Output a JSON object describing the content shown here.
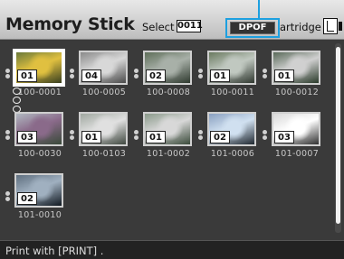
{
  "header": {
    "title": "Memory Stick",
    "select_label": "Select",
    "select_count": "0011",
    "dpof_label": "DPOF",
    "cartridge_label": "artridge",
    "cartridge_size": "L"
  },
  "thumbnails": [
    {
      "name": "100-0001",
      "copies": "01",
      "colors": [
        "#6b7a3a",
        "#e0c040",
        "#3a4020"
      ]
    },
    {
      "name": "100-0005",
      "copies": "04",
      "colors": [
        "#8a8a8a",
        "#d8d8d8",
        "#4a4a4a"
      ]
    },
    {
      "name": "100-0008",
      "copies": "02",
      "colors": [
        "#5f6f5a",
        "#a8b0a8",
        "#2f3a2f"
      ]
    },
    {
      "name": "100-0011",
      "copies": "01",
      "colors": [
        "#6a7a60",
        "#c0c8c0",
        "#303830"
      ]
    },
    {
      "name": "100-0012",
      "copies": "01",
      "colors": [
        "#5a6a5a",
        "#d0d0d0",
        "#2a3a2a"
      ]
    },
    {
      "name": "100-0030",
      "copies": "03",
      "colors": [
        "#b0b8c0",
        "#8a6a8a",
        "#3a4a3a"
      ]
    },
    {
      "name": "100-0103",
      "copies": "01",
      "colors": [
        "#a0a8a0",
        "#e0e0e0",
        "#404840"
      ]
    },
    {
      "name": "101-0002",
      "copies": "01",
      "colors": [
        "#8a9a8a",
        "#d8d8d8",
        "#3a4a3a"
      ]
    },
    {
      "name": "101-0006",
      "copies": "02",
      "colors": [
        "#8aa0c0",
        "#d0e0f0",
        "#202830"
      ]
    },
    {
      "name": "101-0007",
      "copies": "03",
      "colors": [
        "#d8d8d8",
        "#ffffff",
        "#303030"
      ]
    },
    {
      "name": "101-0010",
      "copies": "02",
      "colors": [
        "#607080",
        "#a0b0c0",
        "#101820"
      ]
    }
  ],
  "footer": {
    "text": "Print with [PRINT] ."
  }
}
